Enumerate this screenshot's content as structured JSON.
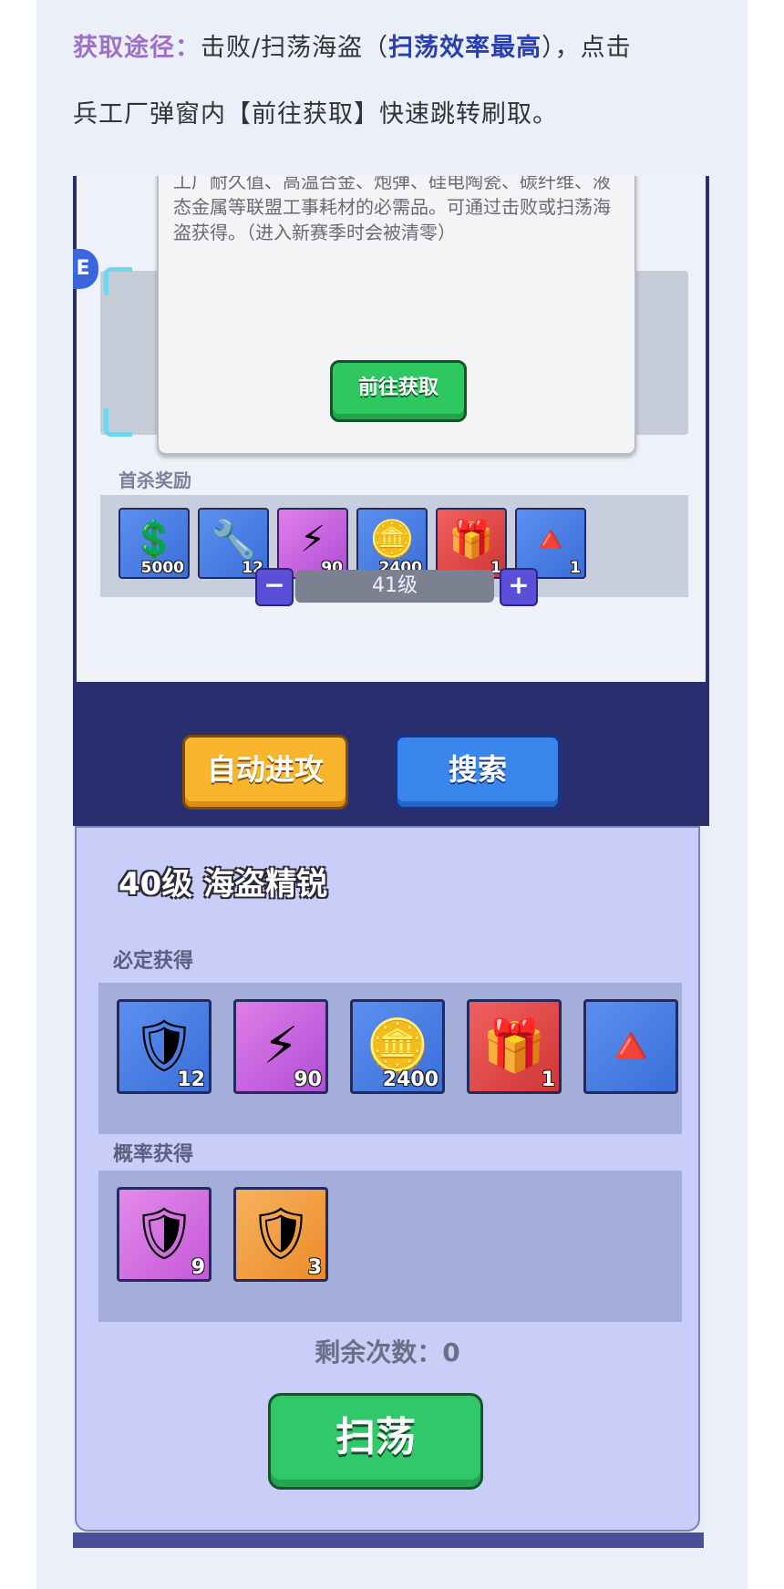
{
  "article": {
    "line1_label": "获取途径：",
    "line1_text_a": "击败/扫荡海盗（",
    "line1_highlight": "扫荡效率最高",
    "line1_text_b": "），点击",
    "line2_text": "兵工厂弹窗内【前往获取】快速跳转刷取。"
  },
  "screen1": {
    "dialog_text": "工厂耐久值、高温合金、炮弹、硅电陶瓷、碳纤维、液态金属等联盟工事耗材的必需品。可通过击败或扫荡海盗获得。（进入新赛季时会被清零）",
    "goto_button": "前往获取",
    "badge_char": "E",
    "first_kill_label": "首杀奖励",
    "rewards": [
      {
        "icon": "s-token-icon",
        "glyph": "💲",
        "color": "blue",
        "qty": "5000"
      },
      {
        "icon": "weapon-part-icon",
        "glyph": "🔧",
        "color": "blue",
        "qty": "12"
      },
      {
        "icon": "energy-crystal-icon",
        "glyph": "⚡",
        "color": "purple",
        "qty": "90"
      },
      {
        "icon": "gold-coin-icon",
        "glyph": "🪙",
        "color": "blue",
        "qty": "2400"
      },
      {
        "icon": "red-chest-icon",
        "glyph": "🎁",
        "color": "red",
        "qty": "1"
      },
      {
        "icon": "pyramid-icon",
        "glyph": "🔺",
        "color": "blue",
        "qty": "1"
      }
    ],
    "minus_label": "−",
    "plus_label": "+",
    "level_value": "41级",
    "auto_attack_button": "自动进攻",
    "search_button": "搜索"
  },
  "screen2": {
    "title": "40级 海盗精锐",
    "guaranteed_label": "必定获得",
    "guaranteed_items": [
      {
        "icon": "armor-icon",
        "glyph": "🛡",
        "color": "blue",
        "qty": "12"
      },
      {
        "icon": "energy-crystal-icon",
        "glyph": "⚡",
        "color": "purple",
        "qty": "90"
      },
      {
        "icon": "gold-coin-icon",
        "glyph": "🪙",
        "color": "blue",
        "qty": "2400"
      },
      {
        "icon": "red-chest-icon",
        "glyph": "🎁",
        "color": "red",
        "qty": "1"
      },
      {
        "icon": "pyramid-icon",
        "glyph": "🔺",
        "color": "blue",
        "qty": ""
      }
    ],
    "chance_label": "概率获得",
    "chance_items": [
      {
        "icon": "armor-icon",
        "glyph": "🛡",
        "color": "pink",
        "qty": "9"
      },
      {
        "icon": "armor-icon",
        "glyph": "🛡",
        "color": "orange",
        "qty": "3"
      }
    ],
    "remaining_label": "剩余次数：0",
    "sweep_button": "扫荡"
  }
}
